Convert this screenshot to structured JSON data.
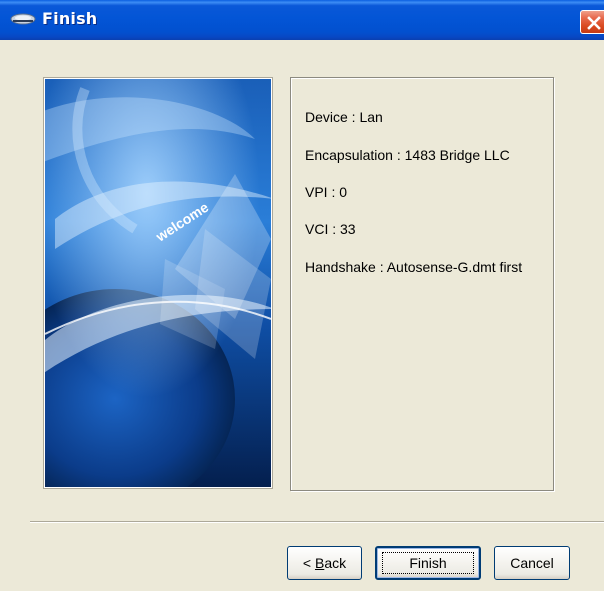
{
  "window": {
    "title": "Finish",
    "icon": "network-app-icon",
    "close_icon": "close-icon"
  },
  "welcome_banner": {
    "text": "welcome"
  },
  "summary": {
    "lines": [
      "Device : Lan",
      "Encapsulation : 1483 Bridge LLC",
      "VPI : 0",
      "VCI : 33",
      "Handshake : Autosense-G.dmt first"
    ]
  },
  "buttons": {
    "back_prefix": "< ",
    "back_mnemonic": "B",
    "back_rest": "ack",
    "finish": "Finish",
    "cancel": "Cancel"
  },
  "colors": {
    "titlebar": "#0355d6",
    "dialog_bg": "#ECE9D8",
    "close_button": "#d9491f"
  }
}
